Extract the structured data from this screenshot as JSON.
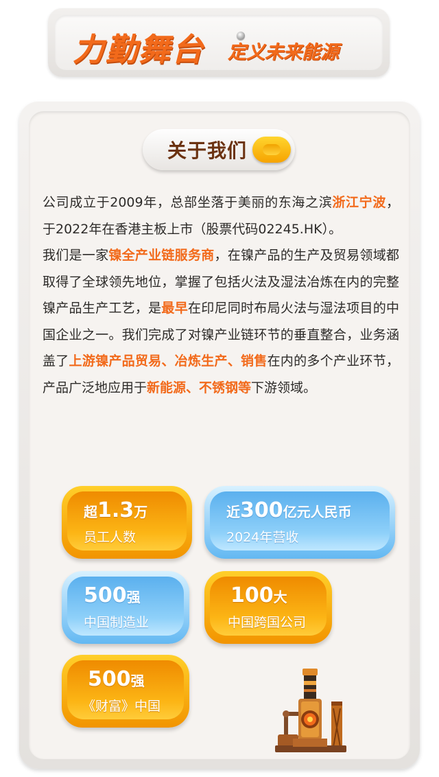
{
  "header": {
    "title": "力勤舞台",
    "subtitle": "定义未来能源"
  },
  "section": {
    "title": "关于我们"
  },
  "about": {
    "p1": [
      {
        "t": "公司成立于2009年，总部坐落于美丽的东海之滨"
      },
      {
        "t": "浙江宁波",
        "hl": true
      },
      {
        "t": "，于2022年在香港主板上市（股票代码02245.HK）。"
      }
    ],
    "p2": [
      {
        "t": "我们是一家"
      },
      {
        "t": "镍全产业链服务商",
        "hl": true
      },
      {
        "t": "，在镍产品的生产及贸易领域都取得了全球领先地位，掌握了包括火法及湿法冶炼在内的完整镍产品生产工艺，是"
      },
      {
        "t": "最早",
        "hl": true
      },
      {
        "t": "在印尼同时布局火法与湿法项目的中国企业之一。我们完成了对镍产业链环节的垂直整合，业务涵盖了"
      },
      {
        "t": "上游镍产品贸易、冶炼生产、销售",
        "hl": true
      },
      {
        "t": "在内的多个产业环节，产品广泛地应用于"
      },
      {
        "t": "新能源、不锈钢等",
        "hl": true
      },
      {
        "t": "下游领域。"
      }
    ]
  },
  "stats": {
    "employees": {
      "prefix": "超",
      "value": "1.3",
      "unit": "万",
      "label": "员工人数"
    },
    "revenue": {
      "prefix": "近",
      "value": "300",
      "unit": "亿元人民币",
      "label": "2024年营收"
    },
    "manufacturing": {
      "prefix": "",
      "value": "500",
      "unit": "强",
      "label": "中国制造业"
    },
    "multinational": {
      "prefix": "",
      "value": "100",
      "unit": "大",
      "label": "中国跨国公司"
    },
    "fortune": {
      "prefix": "",
      "value": "500",
      "unit": "强",
      "label": "《财富》中国"
    }
  },
  "colors": {
    "accent": "#f26a1b",
    "orange_card": "#f9a60c",
    "blue_card": "#7cc6f6",
    "text": "#2d2b29"
  }
}
